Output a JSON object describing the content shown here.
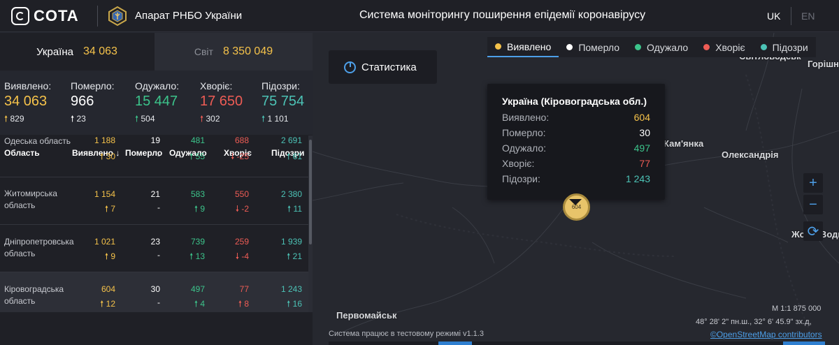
{
  "header": {
    "logo_text": "COTA",
    "rnbo_title": "Апарат РНБО України",
    "system_title": "Система моніторингу поширення епідемії коронавірусу",
    "lang_uk": "UK",
    "lang_en": "EN"
  },
  "tabs": {
    "ukraine": {
      "label": "Україна",
      "value": "34 063"
    },
    "world": {
      "label": "Світ",
      "value": "8 350 049"
    }
  },
  "stats": {
    "detected": {
      "label": "Виявлено:",
      "value": "34 063",
      "delta": "829"
    },
    "died": {
      "label": "Померло:",
      "value": "966",
      "delta": "23"
    },
    "recovered": {
      "label": "Одужало:",
      "value": "15 447",
      "delta": "504"
    },
    "sick": {
      "label": "Хворіє:",
      "value": "17 650",
      "delta": "302"
    },
    "suspected": {
      "label": "Підозри:",
      "value": "75 754",
      "delta": "1 101"
    }
  },
  "table": {
    "headers": {
      "region": "Область",
      "detected": "Виявлено",
      "died": "Померло",
      "recovered": "Одужало",
      "sick": "Хворіє",
      "suspected": "Підозри"
    },
    "rows": [
      {
        "name": "Одеська область",
        "detected": "1 188",
        "detected_d": "30",
        "died": "19",
        "died_d": "-",
        "recovered": "481",
        "recovered_d": "55",
        "sick": "688",
        "sick_d": "-25",
        "suspected": "2 691",
        "suspected_d": "61"
      },
      {
        "name": "Житомирська область",
        "detected": "1 154",
        "detected_d": "7",
        "died": "21",
        "died_d": "-",
        "recovered": "583",
        "recovered_d": "9",
        "sick": "550",
        "sick_d": "-2",
        "suspected": "2 380",
        "suspected_d": "11"
      },
      {
        "name": "Дніпропетровська область",
        "detected": "1 021",
        "detected_d": "9",
        "died": "23",
        "died_d": "-",
        "recovered": "739",
        "recovered_d": "13",
        "sick": "259",
        "sick_d": "-4",
        "suspected": "1 939",
        "suspected_d": "21"
      },
      {
        "name": "Кіровоградська область",
        "detected": "604",
        "detected_d": "12",
        "died": "30",
        "died_d": "-",
        "recovered": "497",
        "recovered_d": "4",
        "sick": "77",
        "sick_d": "8",
        "suspected": "1 243",
        "suspected_d": "16"
      }
    ]
  },
  "map": {
    "stat_button": "Статистика",
    "legend": [
      {
        "label": "Виявлено",
        "color": "#f5c24a"
      },
      {
        "label": "Померло",
        "color": "#ffffff"
      },
      {
        "label": "Одужало",
        "color": "#3cc48b"
      },
      {
        "label": "Хворіє",
        "color": "#ee5c55"
      },
      {
        "label": "Підозри",
        "color": "#4cc3b6"
      }
    ],
    "places": {
      "svitlovodsk": "Світловодськ",
      "horishni": "Горішні",
      "kamianka": "Кам'янка",
      "oleksandriia": "Олександрія",
      "zhovti": "Жовті Води",
      "pervomaisk": "Первомайськ"
    },
    "tooltip": {
      "title": "Україна (Кіровоградська обл.)",
      "rows": [
        {
          "label": "Виявлено:",
          "value": "604"
        },
        {
          "label": "Померло:",
          "value": "30"
        },
        {
          "label": "Одужало:",
          "value": "497"
        },
        {
          "label": "Хворіє:",
          "value": "77"
        },
        {
          "label": "Підозри:",
          "value": "1 243"
        }
      ]
    },
    "marker_value": "604",
    "zoom_in": "+",
    "zoom_out": "−",
    "refresh": "⟳",
    "scale": "М 1:1 875 000",
    "coords": "48° 28' 2\" пн.ш., 32° 6' 45.9\" зх.д,",
    "attribution": "©OpenStreetMap contributors",
    "test_mode": "Система працює в тестовому режимі v1.1.3"
  }
}
